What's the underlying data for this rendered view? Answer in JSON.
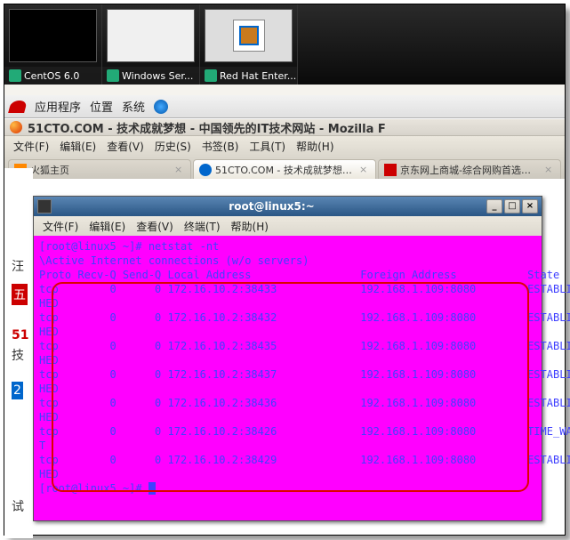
{
  "taskbar": {
    "items": [
      {
        "label": "CentOS 6.0"
      },
      {
        "label": "Windows Ser..."
      },
      {
        "label": "Red Hat Enter..."
      }
    ]
  },
  "gnome": {
    "apps": "应用程序",
    "places": "位置",
    "system": "系统"
  },
  "firefox": {
    "title": "51CTO.COM - 技术成就梦想 - 中国领先的IT技术网站 - Mozilla F",
    "menu": {
      "file": "文件(F)",
      "edit": "编辑(E)",
      "view": "查看(V)",
      "history": "历史(S)",
      "bookmarks": "书签(B)",
      "tools": "工具(T)",
      "help": "帮助(H)"
    },
    "tabs": [
      {
        "label": "火狐主页"
      },
      {
        "label": "51CTO.COM - 技术成就梦想…"
      },
      {
        "label": "京东网上商城-综合网购首选…"
      }
    ]
  },
  "terminal": {
    "title": "root@linux5:~",
    "menu": {
      "file": "文件(F)",
      "edit": "编辑(E)",
      "view": "查看(V)",
      "terminal": "终端(T)",
      "help": "帮助(H)"
    },
    "prompt": "[root@linux5 ~]# ",
    "cmd": "netstat -nt",
    "heading1": "\\Active Internet connections (w/o servers)",
    "heading2_proto": "Proto",
    "heading2_recv": "Recv-Q",
    "heading2_send": "Send-Q",
    "heading2_local": "Local Address",
    "heading2_foreign": "Foreign Address",
    "heading2_state": "State",
    "rows": [
      {
        "proto": "tcp",
        "recv": "0",
        "send": "0",
        "local": "172.16.10.2:38433",
        "foreign": "192.168.1.109:8080",
        "state": "ESTABLIS",
        "wrap": "HED"
      },
      {
        "proto": "tcp",
        "recv": "0",
        "send": "0",
        "local": "172.16.10.2:38432",
        "foreign": "192.168.1.109:8080",
        "state": "ESTABLIS",
        "wrap": "HED"
      },
      {
        "proto": "tcp",
        "recv": "0",
        "send": "0",
        "local": "172.16.10.2:38435",
        "foreign": "192.168.1.109:8080",
        "state": "ESTABLIS",
        "wrap": "HED"
      },
      {
        "proto": "tcp",
        "recv": "0",
        "send": "0",
        "local": "172.16.10.2:38437",
        "foreign": "192.168.1.109:8080",
        "state": "ESTABLIS",
        "wrap": "HED"
      },
      {
        "proto": "tcp",
        "recv": "0",
        "send": "0",
        "local": "172.16.10.2:38436",
        "foreign": "192.168.1.109:8080",
        "state": "ESTABLIS",
        "wrap": "HED"
      },
      {
        "proto": "tcp",
        "recv": "0",
        "send": "0",
        "local": "172.16.10.2:38426",
        "foreign": "192.168.1.109:8080",
        "state": "TIME_WAI",
        "wrap": "T"
      },
      {
        "proto": "tcp",
        "recv": "0",
        "send": "0",
        "local": "172.16.10.2:38429",
        "foreign": "192.168.1.109:8080",
        "state": "ESTABLIS",
        "wrap": "HED"
      }
    ],
    "prompt2": "[root@linux5 ~]# "
  },
  "left_snippets": [
    "汪",
    "五",
    "51",
    "技",
    "2",
    "试"
  ]
}
